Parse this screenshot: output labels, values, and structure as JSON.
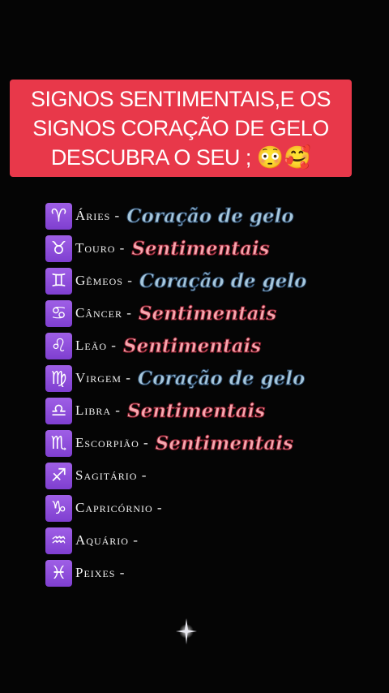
{
  "banner": {
    "lines": [
      "SIGNOS SENTIMENTAIS,E OS",
      "SIGNOS CORAÇÃO DE GELO",
      "DESCUBRA O SEU ; 😳🥰"
    ],
    "bg_color": "#e8384a"
  },
  "signs": [
    {
      "glyph": "♈",
      "icon": "aries-icon",
      "name": "Áries -",
      "result": "Coração de gelo",
      "type": "gelo"
    },
    {
      "glyph": "♉",
      "icon": "taurus-icon",
      "name": "Touro  -",
      "result": "Sentimentais",
      "type": "sent"
    },
    {
      "glyph": "♊",
      "icon": "gemini-icon",
      "name": "Gêmeos -",
      "result": "Coração de gelo",
      "type": "gelo"
    },
    {
      "glyph": "♋",
      "icon": "cancer-icon",
      "name": "Câncer  -",
      "result": "Sentimentais",
      "type": "sent"
    },
    {
      "glyph": "♌",
      "icon": "leo-icon",
      "name": "Leão  -",
      "result": "Sentimentais",
      "type": "sent"
    },
    {
      "glyph": "♍",
      "icon": "virgo-icon",
      "name": "Virgem -",
      "result": "Coração de gelo",
      "type": "gelo"
    },
    {
      "glyph": "♎",
      "icon": "libra-icon",
      "name": "Libra -",
      "result": "Sentimentais",
      "type": "sent"
    },
    {
      "glyph": "♏",
      "icon": "scorpio-icon",
      "name": "Escorpião -",
      "result": "Sentimentais",
      "type": "sent"
    },
    {
      "glyph": "♐",
      "icon": "sagittarius-icon",
      "name": "Sagitário  -",
      "result": "",
      "type": ""
    },
    {
      "glyph": "♑",
      "icon": "capricorn-icon",
      "name": "Capricórnio -",
      "result": "",
      "type": ""
    },
    {
      "glyph": "♒",
      "icon": "aquarius-icon",
      "name": "Aquário -",
      "result": "",
      "type": ""
    },
    {
      "glyph": "♓",
      "icon": "pisces-icon",
      "name": "Peixes -",
      "result": "",
      "type": ""
    }
  ],
  "colors": {
    "background": "#050505",
    "icon_purple": "#8f4fdc",
    "gelo_text": "#a8c8dc",
    "sentimentais_text": "#f6a8b0"
  }
}
